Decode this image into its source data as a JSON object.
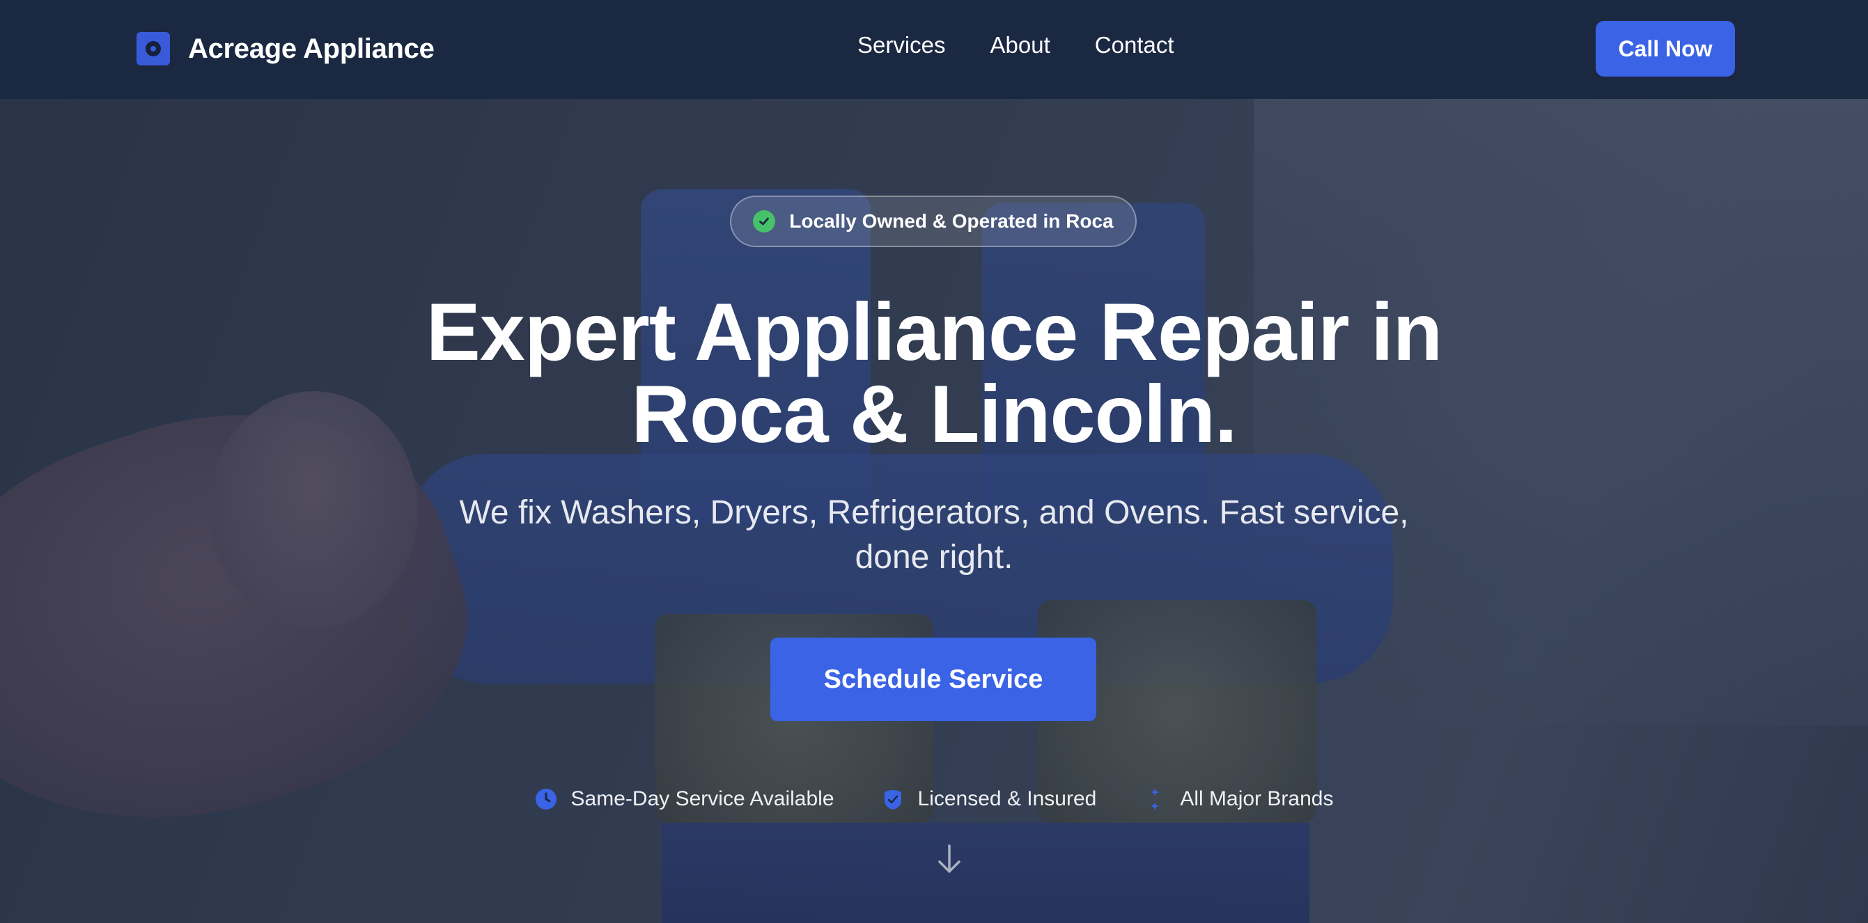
{
  "navbar": {
    "brand_name": "Acreage Appliance",
    "links": [
      "Services",
      "About",
      "Contact"
    ],
    "call_button": "Call Now"
  },
  "hero": {
    "badge_text": "Locally Owned & Operated in Roca",
    "headline_line1": "Expert Appliance Repair in",
    "headline_line2": "Roca & Lincoln.",
    "subheadline": "We fix Washers, Dryers, Refrigerators, and Ovens. Fast service, done right.",
    "cta_button": "Schedule Service",
    "features": [
      {
        "icon": "clock-icon",
        "label": "Same-Day Service Available"
      },
      {
        "icon": "shield-check-icon",
        "label": "Licensed & Insured"
      },
      {
        "icon": "sparkles-icon",
        "label": "All Major Brands"
      }
    ]
  },
  "colors": {
    "nav_bg": "#1b2842",
    "accent": "#3a63e6",
    "badge_check": "#47c16a"
  }
}
